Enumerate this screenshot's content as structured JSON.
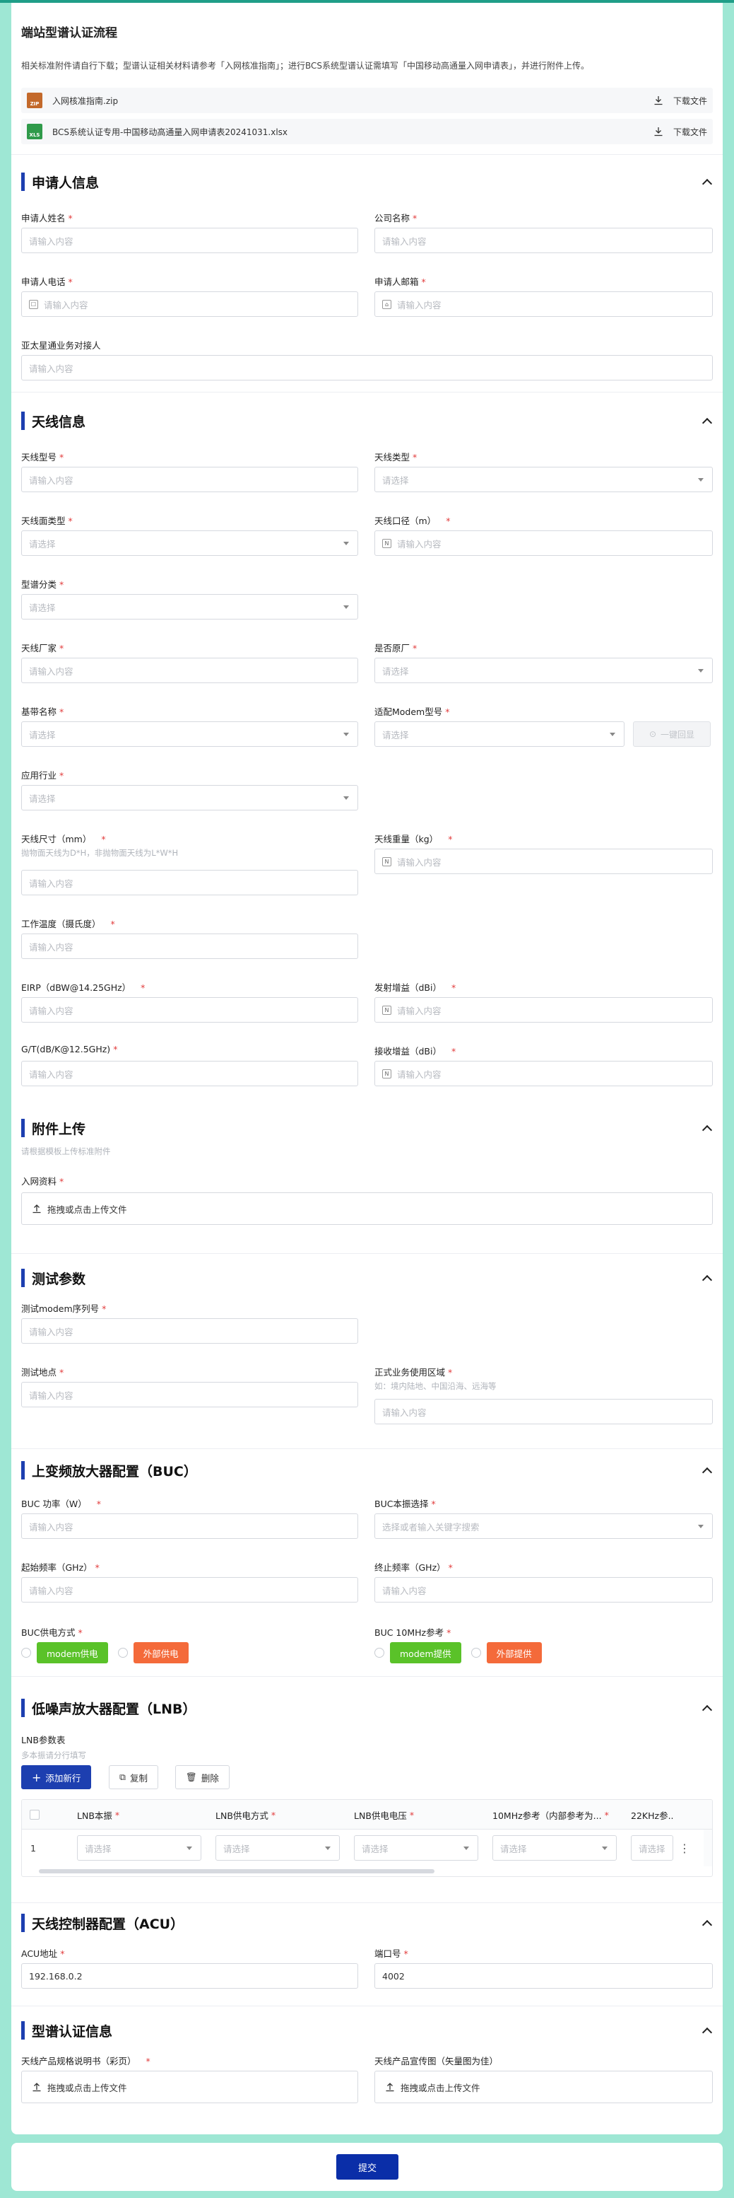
{
  "header": {
    "title": "端站型谱认证流程",
    "description": "相关标准附件请自行下载；型谱认证相关材料请参考「入网核准指南」；进行BCS系统型谱认证需填写「中国移动高通量入网申请表」，并进行附件上传。",
    "files": [
      {
        "name": "入网核准指南.zip",
        "icon_text": "ZIP",
        "icon_color": "#c3692b",
        "download_label": "下载文件"
      },
      {
        "name": "BCS系统认证专用-中国移动高通量入网申请表20241031.xlsx",
        "icon_text": "XLS",
        "icon_color": "#2f9a4a",
        "download_label": "下载文件"
      }
    ]
  },
  "colors": {
    "accent": "#1d3fb0",
    "required": "#e23c3c",
    "green_tag": "#5ac229",
    "orange_tag": "#f46a3a",
    "page_bg": "#9ee7d4"
  },
  "sections": {
    "applicant": {
      "title": "申请人信息",
      "name_label": "申请人姓名",
      "name_placeholder": "请输入内容",
      "company_label": "公司名称",
      "company_placeholder": "请输入内容",
      "phone_label": "申请人电话",
      "phone_placeholder": "请输入内容",
      "email_label": "申请人邮箱",
      "email_placeholder": "请输入内容",
      "contact_label": "亚太星通业务对接人",
      "contact_placeholder": "请输入内容"
    },
    "antenna": {
      "title": "天线信息",
      "model_label": "天线型号",
      "model_placeholder": "请输入内容",
      "type_label": "天线类型",
      "type_placeholder": "请选择",
      "surface_label": "天线面类型",
      "surface_placeholder": "请选择",
      "aperture_label": "天线口径（m）",
      "aperture_placeholder": "请输入内容",
      "spectrum_label": "型谱分类",
      "spectrum_placeholder": "请选择",
      "maker_label": "天线厂家",
      "maker_placeholder": "请输入内容",
      "original_label": "是否原厂",
      "original_placeholder": "请选择",
      "baseband_label": "基带名称",
      "baseband_placeholder": "请选择",
      "modem_label": "适配Modem型号",
      "modem_placeholder": "请选择",
      "onekey_label": "一键回显",
      "industry_label": "应用行业",
      "industry_placeholder": "请选择",
      "size_label": "天线尺寸（mm）",
      "size_hint": "抛物面天线为D*H，非抛物面天线为L*W*H",
      "size_placeholder": "请输入内容",
      "weight_label": "天线重量（kg）",
      "weight_placeholder": "请输入内容",
      "temp_label": "工作温度（摄氏度）",
      "temp_placeholder": "请输入内容",
      "eirp_label": "EIRP（dBW@14.25GHz）",
      "eirp_placeholder": "请输入内容",
      "txgain_label": "发射增益（dBi）",
      "txgain_placeholder": "请输入内容",
      "gt_label": "G/T(dB/K@12.5GHz)",
      "gt_placeholder": "请输入内容",
      "rxgain_label": "接收增益（dBi）",
      "rxgain_placeholder": "请输入内容"
    },
    "attachment": {
      "title": "附件上传",
      "hint": "请根据模板上传标准附件",
      "material_label": "入网资料",
      "upload_text": "拖拽或点击上传文件"
    },
    "test": {
      "title": "测试参数",
      "serial_label": "测试modem序列号",
      "serial_placeholder": "请输入内容",
      "site_label": "测试地点",
      "site_placeholder": "请输入内容",
      "area_label": "正式业务使用区域",
      "area_hint": "如：境内陆地、中国沿海、远海等",
      "area_placeholder": "请输入内容"
    },
    "buc": {
      "title": "上变频放大器配置（BUC）",
      "power_label": "BUC 功率（W）",
      "power_placeholder": "请输入内容",
      "lo_label": "BUC本振选择",
      "lo_placeholder": "选择或者输入关键字搜索",
      "start_label": "起始频率（GHz）",
      "start_placeholder": "请输入内容",
      "end_label": "终止频率（GHz）",
      "end_placeholder": "请输入内容",
      "supply_label": "BUC供电方式",
      "supply_opt1": "modem供电",
      "supply_opt2": "外部供电",
      "ref_label": "BUC 10MHz参考",
      "ref_opt1": "modem提供",
      "ref_opt2": "外部提供"
    },
    "lnb": {
      "title": "低噪声放大器配置（LNB）",
      "table_label": "LNB参数表",
      "table_hint": "多本振请分行填写",
      "add_label": "添加新行",
      "copy_label": "复制",
      "delete_label": "删除",
      "columns": [
        "LNB本振",
        "LNB供电方式",
        "LNB供电电压",
        "10MHz参考（内部参考为...",
        "22KHz参..."
      ],
      "row": {
        "index": "1",
        "placeholder": "请选择"
      }
    },
    "acu": {
      "title": "天线控制器配置（ACU）",
      "address_label": "ACU地址",
      "address_value": "192.168.0.2",
      "port_label": "端口号",
      "port_value": "4002"
    },
    "cert": {
      "title": "型谱认证信息",
      "manual_label": "天线产品规格说明书（彩页）",
      "promo_label": "天线产品宣传图（矢量图为佳）",
      "upload_text": "拖拽或点击上传文件"
    }
  },
  "submit_label": "提交"
}
